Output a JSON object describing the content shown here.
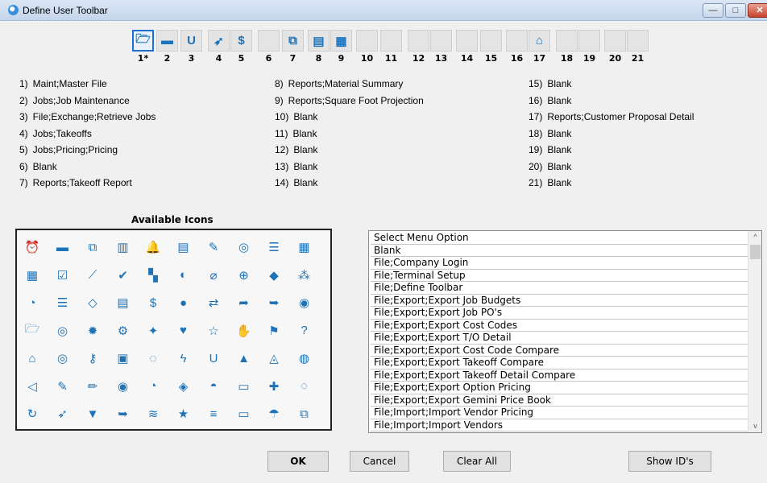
{
  "window": {
    "title": "Define User Toolbar"
  },
  "titlebar_buttons": {
    "minimize": "—",
    "maximize": "□",
    "close": "✕"
  },
  "slots": [
    {
      "num": "1*",
      "icon": "folder-open-icon",
      "glyph": "🗁",
      "selected": true
    },
    {
      "num": "2",
      "icon": "archive-icon",
      "glyph": "▬"
    },
    {
      "num": "3",
      "icon": "magnet-icon",
      "glyph": "U"
    },
    {
      "num": "4",
      "icon": "rocket-icon",
      "glyph": "➶"
    },
    {
      "num": "5",
      "icon": "dollar-icon",
      "glyph": "$"
    },
    {
      "num": "6",
      "icon": "blank-icon",
      "glyph": ""
    },
    {
      "num": "7",
      "icon": "copy-icon",
      "glyph": "⧉"
    },
    {
      "num": "8",
      "icon": "calculator-icon",
      "glyph": "▤"
    },
    {
      "num": "9",
      "icon": "calculator-alt-icon",
      "glyph": "▦"
    },
    {
      "num": "10",
      "icon": "blank-icon",
      "glyph": ""
    },
    {
      "num": "11",
      "icon": "blank-icon",
      "glyph": ""
    },
    {
      "num": "12",
      "icon": "blank-icon",
      "glyph": ""
    },
    {
      "num": "13",
      "icon": "blank-icon",
      "glyph": ""
    },
    {
      "num": "14",
      "icon": "blank-icon",
      "glyph": ""
    },
    {
      "num": "15",
      "icon": "blank-icon",
      "glyph": ""
    },
    {
      "num": "16",
      "icon": "blank-icon",
      "glyph": ""
    },
    {
      "num": "17",
      "icon": "home-icon",
      "glyph": "⌂"
    },
    {
      "num": "18",
      "icon": "blank-icon",
      "glyph": ""
    },
    {
      "num": "19",
      "icon": "blank-icon",
      "glyph": ""
    },
    {
      "num": "20",
      "icon": "blank-icon",
      "glyph": ""
    },
    {
      "num": "21",
      "icon": "blank-icon",
      "glyph": ""
    }
  ],
  "assignments": {
    "col1": [
      {
        "n": "1)",
        "t": "Maint;Master File"
      },
      {
        "n": "2)",
        "t": "Jobs;Job Maintenance"
      },
      {
        "n": "3)",
        "t": "File;Exchange;Retrieve Jobs"
      },
      {
        "n": "4)",
        "t": "Jobs;Takeoffs"
      },
      {
        "n": "5)",
        "t": "Jobs;Pricing;Pricing"
      },
      {
        "n": "6)",
        "t": "Blank"
      },
      {
        "n": "7)",
        "t": "Reports;Takeoff Report"
      }
    ],
    "col2": [
      {
        "n": "8)",
        "t": "Reports;Material Summary"
      },
      {
        "n": "9)",
        "t": "Reports;Square Foot Projection"
      },
      {
        "n": "10)",
        "t": "Blank"
      },
      {
        "n": "11)",
        "t": "Blank"
      },
      {
        "n": "12)",
        "t": "Blank"
      },
      {
        "n": "13)",
        "t": "Blank"
      },
      {
        "n": "14)",
        "t": "Blank"
      }
    ],
    "col3": [
      {
        "n": "15)",
        "t": "Blank"
      },
      {
        "n": "16)",
        "t": "Blank"
      },
      {
        "n": "17)",
        "t": "Reports;Customer Proposal Detail"
      },
      {
        "n": "18)",
        "t": "Blank"
      },
      {
        "n": "19)",
        "t": "Blank"
      },
      {
        "n": "20)",
        "t": "Blank"
      },
      {
        "n": "21)",
        "t": "Blank"
      }
    ]
  },
  "available_icons_label": "Available Icons",
  "available_icons": [
    [
      "alarm-clock-icon",
      "archive-icon",
      "copy-icon",
      "bar-chart-icon",
      "bell-icon",
      "calculator-icon",
      "paintbrush-icon",
      "target-icon",
      "database-icon",
      "calculator-alt-icon"
    ],
    [
      "calendar-icon",
      "calendar-check-icon",
      "line-chart-icon",
      "checkbox-icon",
      "tiles-icon",
      "contrast-icon",
      "paperclip-icon",
      "crosshair-icon",
      "cube-icon",
      "cubes-icon"
    ],
    [
      "dashboard-icon",
      "database-stack-icon",
      "diamond-icon",
      "file-icon",
      "dollar-icon",
      "droplet-icon",
      "exchange-icon",
      "export-icon",
      "sign-out-icon",
      "eye-icon"
    ],
    [
      "folder-open-icon",
      "fingerprint-icon",
      "gear-icon",
      "gears-icon",
      "users-icon",
      "heart-broken-icon",
      "star-half-icon",
      "hand-icon",
      "flag-icon",
      "question-icon"
    ],
    [
      "home-icon",
      "compass-icon",
      "key-icon",
      "keyboard-icon",
      "lightbulb-icon",
      "lightning-icon",
      "magnet-icon",
      "navigation-icon",
      "paint-bucket-icon",
      "palette-icon"
    ],
    [
      "paper-plane-icon",
      "edit-icon",
      "pencil-icon",
      "user-circle-icon",
      "pie-chart-icon",
      "map-marker-icon",
      "satellite-icon",
      "printer-icon",
      "puzzle-icon",
      "recycle-icon"
    ],
    [
      "refresh-icon",
      "rocket-icon",
      "shield-icon",
      "sign-in-icon",
      "layers-icon",
      "star-icon",
      "server-icon",
      "comment-icon",
      "umbrella-icon",
      "window-restore-icon"
    ]
  ],
  "available_glyphs": [
    [
      "⏰",
      "▬",
      "⧉",
      "▥",
      "🔔",
      "▤",
      "✎",
      "◎",
      "☰",
      "▦"
    ],
    [
      "▦",
      "☑",
      "⟋",
      "✔",
      "▚",
      "◐",
      "⌀",
      "⊕",
      "◆",
      "⁂"
    ],
    [
      "◔",
      "☰",
      "◇",
      "▤",
      "$",
      "●",
      "⇄",
      "➦",
      "➥",
      "◉"
    ],
    [
      "🗁",
      "◎",
      "✹",
      "⚙",
      "✦",
      "♥",
      "☆",
      "✋",
      "⚑",
      "?"
    ],
    [
      "⌂",
      "◎",
      "⚷",
      "▣",
      "◌",
      "ϟ",
      "U",
      "▲",
      "◬",
      "◍"
    ],
    [
      "◁",
      "✎",
      "✏",
      "◉",
      "◔",
      "◈",
      "◓",
      "▭",
      "✚",
      "◌"
    ],
    [
      "↻",
      "➶",
      "▼",
      "➥",
      "≋",
      "★",
      "≡",
      "▭",
      "☂",
      "⧉"
    ]
  ],
  "menu_list": {
    "items": [
      "Select Menu Option",
      "Blank",
      "File;Company Login",
      "File;Terminal Setup",
      "File;Define Toolbar",
      "File;Export;Export Job Budgets",
      "File;Export;Export Job PO's",
      "File;Export;Export Cost Codes",
      "File;Export;Export T/O Detail",
      "File;Export;Export Cost Code Compare",
      "File;Export;Export Takeoff Compare",
      "File;Export;Export Takeoff Detail Compare",
      "File;Export;Export Option Pricing",
      "File;Export;Export Gemini Price Book",
      "File;Import;Import Vendor Pricing",
      "File;Import;Import Vendors"
    ],
    "scroll_up": "^",
    "scroll_down": "v"
  },
  "buttons": {
    "ok": "OK",
    "cancel": "Cancel",
    "clear_all": "Clear All",
    "show_ids": "Show ID's"
  },
  "colors": {
    "icon_blue": "#1d72b8",
    "selected_border": "#1e6fd0"
  }
}
